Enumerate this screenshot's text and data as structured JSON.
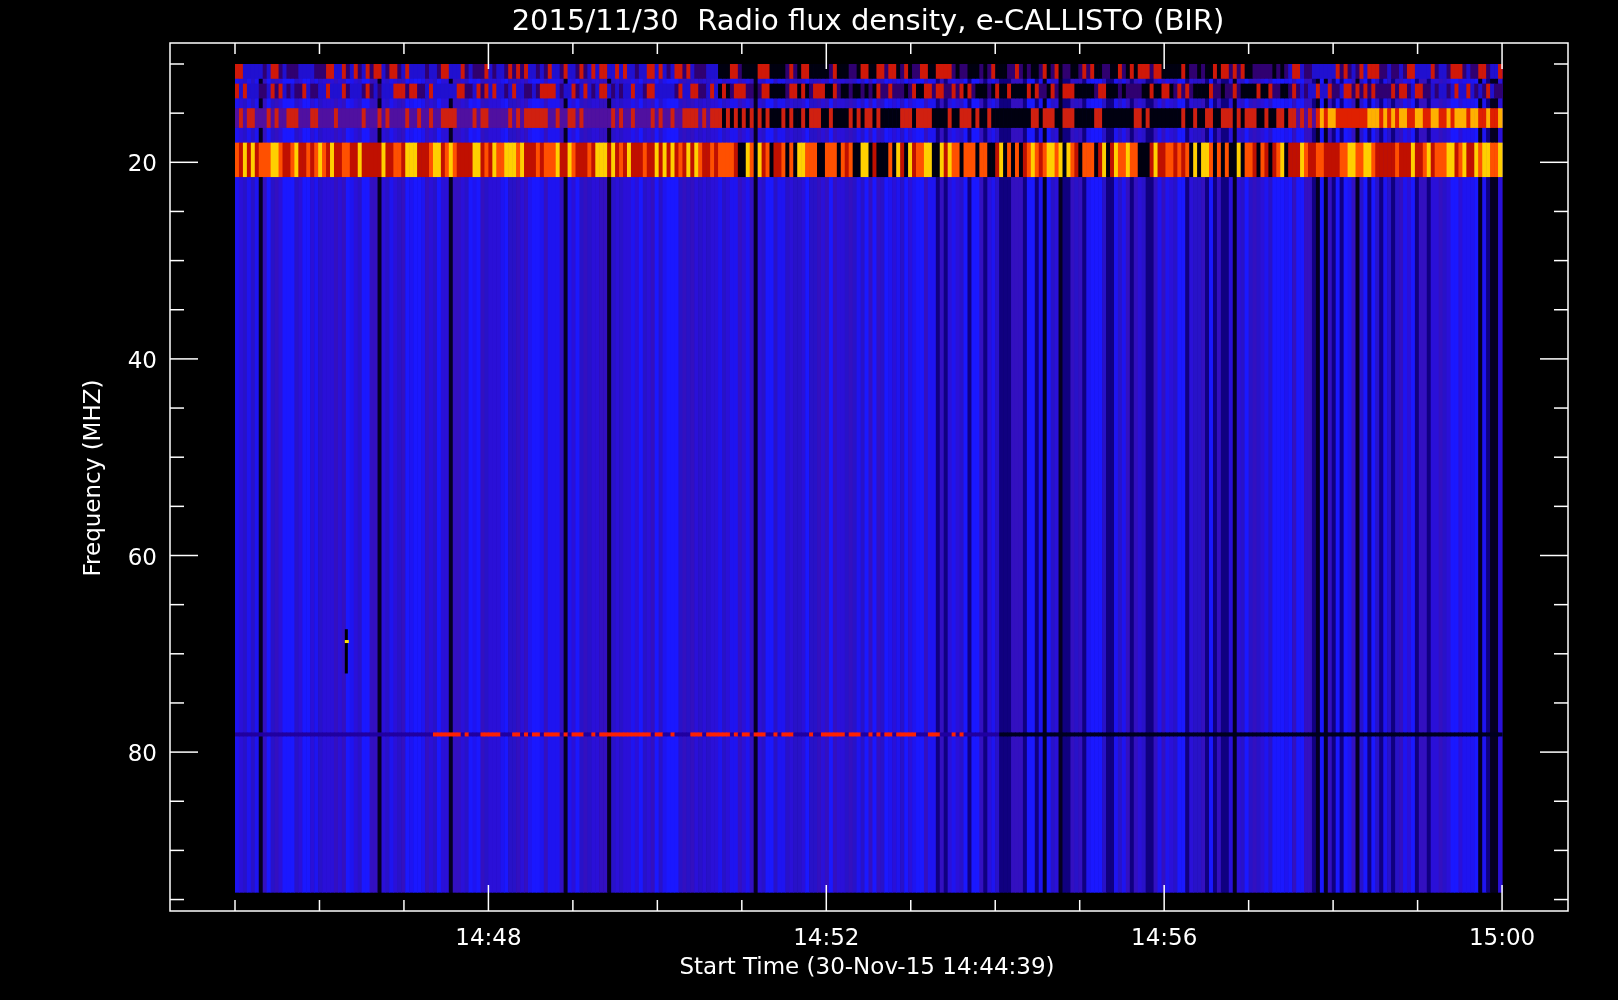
{
  "title": "2015/11/30  Radio flux density, e-CALLISTO (BIR)",
  "y_axis": {
    "label": "Frequency (MHZ)",
    "tick_labels": [
      "20",
      "40",
      "60",
      "80"
    ]
  },
  "x_axis": {
    "label": "Start Time (30-Nov-15 14:44:39)",
    "tick_labels": [
      "14:48",
      "14:52",
      "14:56",
      "15:00"
    ]
  }
}
